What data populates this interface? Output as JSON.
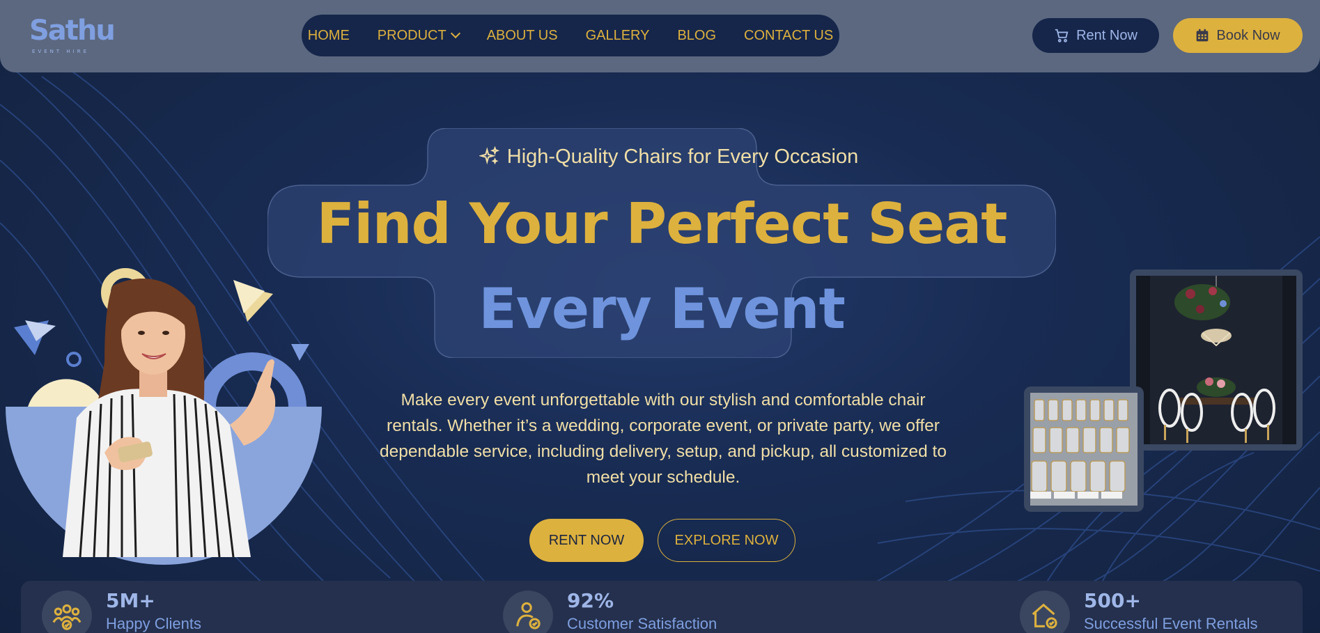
{
  "brand": {
    "name": "Sathu",
    "tagline": "EVENT HIRE"
  },
  "nav": {
    "items": [
      {
        "label": "HOME"
      },
      {
        "label": "PRODUCT"
      },
      {
        "label": "ABOUT US"
      },
      {
        "label": "GALLERY"
      },
      {
        "label": "BLOG"
      },
      {
        "label": "CONTACT US"
      }
    ]
  },
  "header_actions": {
    "rent_label": "Rent Now",
    "book_label": "Book Now"
  },
  "hero": {
    "tagline": "High-Quality Chairs for Every Occasion",
    "headline_line1": "Find Your Perfect Seat",
    "headline_line2": "Every Event",
    "description": "Make every event unforgettable with our stylish and comfortable chair rentals. Whether it’s a wedding, corporate event, or private party, we offer dependable service, including delivery, setup, and pickup, all customized to meet your schedule.",
    "primary_cta": "RENT NOW",
    "secondary_cta": "EXPLORE NOW"
  },
  "stats": [
    {
      "value": "5M+",
      "label": "Happy Clients",
      "icon": "users-icon"
    },
    {
      "value": "92%",
      "label": "Customer Satisfaction",
      "icon": "user-check-icon"
    },
    {
      "value": "500+",
      "label": "Successful Event Rentals",
      "icon": "home-check-icon"
    }
  ],
  "colors": {
    "accent_gold": "#ddb13e",
    "accent_blue": "#6f94dd",
    "navy": "#16264a",
    "header_bg": "#5c6880"
  }
}
